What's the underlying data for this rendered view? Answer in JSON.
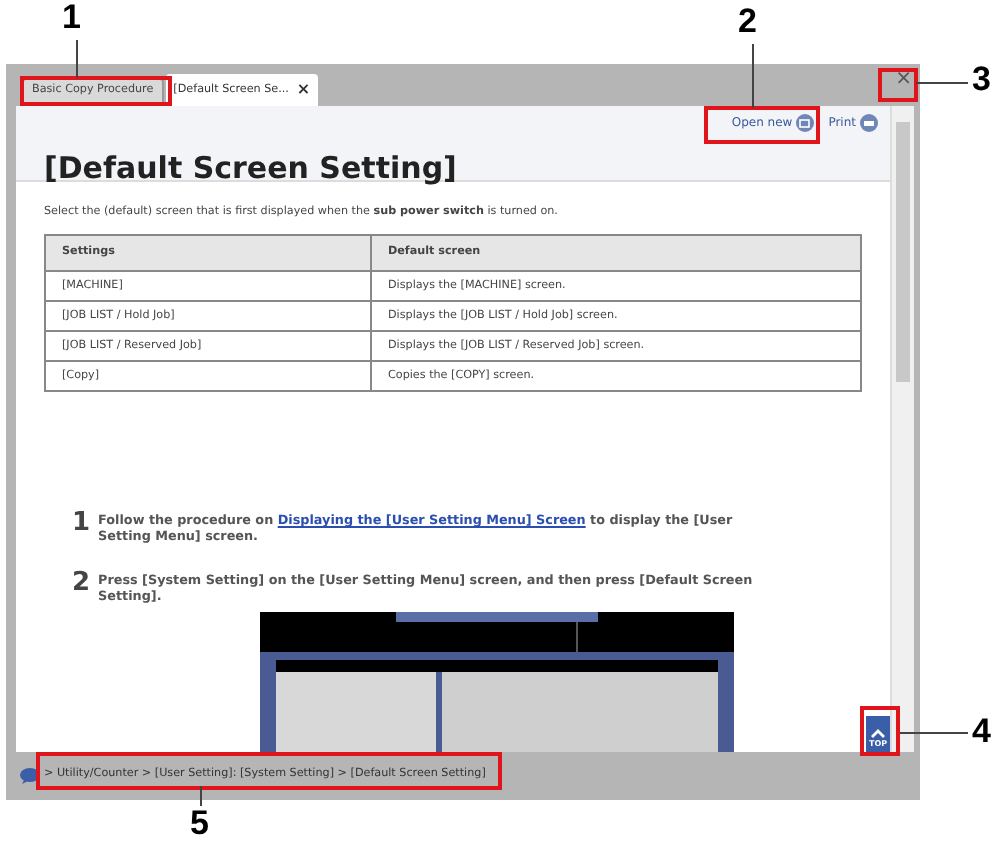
{
  "callouts": [
    {
      "label": "1"
    },
    {
      "label": "2"
    },
    {
      "label": "3"
    },
    {
      "label": "4"
    },
    {
      "label": "5"
    }
  ],
  "tabs": [
    {
      "label": "Basic Copy Procedure",
      "selected": false
    },
    {
      "label": "[Default Screen Se...",
      "selected": true,
      "close": "×"
    }
  ],
  "window_close": "×",
  "toolbar": {
    "open_new": "Open new",
    "print": "Print"
  },
  "title": "[Default Screen Setting]",
  "intro": "Select the (default) screen that is first displayed when the **sub power switch** is turned on.",
  "table": {
    "columns": [
      "Settings",
      "Default screen"
    ],
    "rows": [
      [
        "[MACHINE]",
        "Displays the [MACHINE] screen."
      ],
      [
        "[JOB LIST / Hold Job]",
        "Displays the [JOB LIST / Hold Job] screen."
      ],
      [
        "[JOB LIST / Reserved Job]",
        "Displays the [JOB LIST / Reserved Job] screen."
      ],
      [
        "[Copy]",
        "Copies the [COPY] screen."
      ]
    ]
  },
  "steps": [
    {
      "number": "1",
      "text_before": "Follow the procedure on",
      "link": "Displaying the [User Setting Menu] Screen",
      "text_after": "to display the [User Setting Menu] screen."
    },
    {
      "number": "2",
      "text_before": "Press [System Setting] on the [User Setting Menu] screen, and then press [Default Screen Setting]."
    }
  ],
  "top_button": "TOP",
  "breadcrumb": "> Utility/Counter > [User Setting]: [System Setting] > [Default Screen Setting]"
}
